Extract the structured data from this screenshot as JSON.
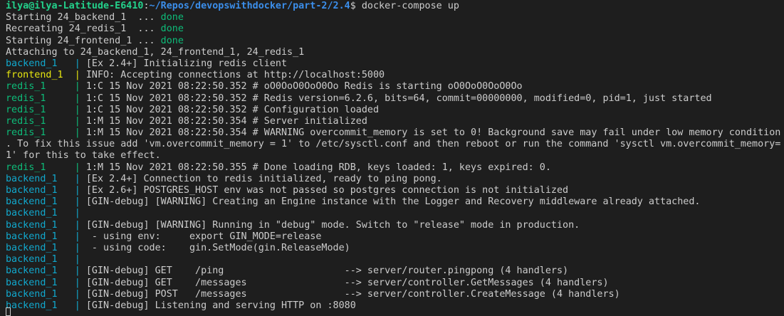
{
  "colors": {
    "background": "#1e1e1e",
    "text": "#cccccc",
    "user": "#23d18b",
    "path": "#3b8eea",
    "done": "#0dbc79",
    "backend": "#11a8cd",
    "frontend": "#e5e510",
    "redis": "#0dbc79"
  },
  "lines": [
    [
      {
        "t": "ilya@ilya-Latitude-E6410",
        "c": "user"
      },
      {
        "t": ":",
        "c": "text"
      },
      {
        "t": "~/Repos/devopswithdocker/part-2/2.4",
        "c": "path"
      },
      {
        "t": "$ docker-compose up",
        "c": "text"
      }
    ],
    [
      {
        "t": "Starting 24_backend_1  ... ",
        "c": "text"
      },
      {
        "t": "done",
        "c": "done"
      }
    ],
    [
      {
        "t": "Recreating 24_redis_1  ... ",
        "c": "text"
      },
      {
        "t": "done",
        "c": "done"
      }
    ],
    [
      {
        "t": "Starting 24_frontend_1 ... ",
        "c": "text"
      },
      {
        "t": "done",
        "c": "done"
      }
    ],
    [
      {
        "t": "Attaching to 24_backend_1, 24_frontend_1, 24_redis_1",
        "c": "text"
      }
    ],
    [
      {
        "t": "backend_1   | ",
        "c": "backend"
      },
      {
        "t": "[Ex 2.4+] Initializing redis client",
        "c": "text"
      }
    ],
    [
      {
        "t": "frontend_1  | ",
        "c": "frontend"
      },
      {
        "t": "INFO: Accepting connections at http://localhost:5000",
        "c": "text"
      }
    ],
    [
      {
        "t": "redis_1     | ",
        "c": "redis"
      },
      {
        "t": "1:C 15 Nov 2021 08:22:50.352 # oO0OoO0OoO0Oo Redis is starting oO0OoO0OoO0Oo",
        "c": "text"
      }
    ],
    [
      {
        "t": "redis_1     | ",
        "c": "redis"
      },
      {
        "t": "1:C 15 Nov 2021 08:22:50.352 # Redis version=6.2.6, bits=64, commit=00000000, modified=0, pid=1, just started",
        "c": "text"
      }
    ],
    [
      {
        "t": "redis_1     | ",
        "c": "redis"
      },
      {
        "t": "1:C 15 Nov 2021 08:22:50.352 # Configuration loaded",
        "c": "text"
      }
    ],
    [
      {
        "t": "redis_1     | ",
        "c": "redis"
      },
      {
        "t": "1:M 15 Nov 2021 08:22:50.354 # Server initialized",
        "c": "text"
      }
    ],
    [
      {
        "t": "redis_1     | ",
        "c": "redis"
      },
      {
        "t": "1:M 15 Nov 2021 08:22:50.354 # WARNING overcommit_memory is set to 0! Background save may fail under low memory condition",
        "c": "text"
      }
    ],
    [
      {
        "t": ". To fix this issue add 'vm.overcommit_memory = 1' to /etc/sysctl.conf and then reboot or run the command 'sysctl vm.overcommit_memory=",
        "c": "text"
      }
    ],
    [
      {
        "t": "1' for this to take effect.",
        "c": "text"
      }
    ],
    [
      {
        "t": "redis_1     | ",
        "c": "redis"
      },
      {
        "t": "1:M 15 Nov 2021 08:22:50.355 # Done loading RDB, keys loaded: 1, keys expired: 0.",
        "c": "text"
      }
    ],
    [
      {
        "t": "backend_1   | ",
        "c": "backend"
      },
      {
        "t": "[Ex 2.4+] Connection to redis initialized, ready to ping pong.",
        "c": "text"
      }
    ],
    [
      {
        "t": "backend_1   | ",
        "c": "backend"
      },
      {
        "t": "[Ex 2.6+] POSTGRES_HOST env was not passed so postgres connection is not initialized",
        "c": "text"
      }
    ],
    [
      {
        "t": "backend_1   | ",
        "c": "backend"
      },
      {
        "t": "[GIN-debug] [WARNING] Creating an Engine instance with the Logger and Recovery middleware already attached.",
        "c": "text"
      }
    ],
    [
      {
        "t": "backend_1   | ",
        "c": "backend"
      }
    ],
    [
      {
        "t": "backend_1   | ",
        "c": "backend"
      },
      {
        "t": "[GIN-debug] [WARNING] Running in \"debug\" mode. Switch to \"release\" mode in production.",
        "c": "text"
      }
    ],
    [
      {
        "t": "backend_1   | ",
        "c": "backend"
      },
      {
        "t": " - using env:\texport GIN_MODE=release",
        "c": "text"
      }
    ],
    [
      {
        "t": "backend_1   | ",
        "c": "backend"
      },
      {
        "t": " - using code:\tgin.SetMode(gin.ReleaseMode)",
        "c": "text"
      }
    ],
    [
      {
        "t": "backend_1   | ",
        "c": "backend"
      }
    ],
    [
      {
        "t": "backend_1   | ",
        "c": "backend"
      },
      {
        "t": "[GIN-debug] GET    /ping                     --> server/router.pingpong (4 handlers)",
        "c": "text"
      }
    ],
    [
      {
        "t": "backend_1   | ",
        "c": "backend"
      },
      {
        "t": "[GIN-debug] GET    /messages                 --> server/controller.GetMessages (4 handlers)",
        "c": "text"
      }
    ],
    [
      {
        "t": "backend_1   | ",
        "c": "backend"
      },
      {
        "t": "[GIN-debug] POST   /messages                 --> server/controller.CreateMessage (4 handlers)",
        "c": "text"
      }
    ],
    [
      {
        "t": "backend_1   | ",
        "c": "backend"
      },
      {
        "t": "[GIN-debug] Listening and serving HTTP on :8080",
        "c": "text"
      }
    ]
  ]
}
